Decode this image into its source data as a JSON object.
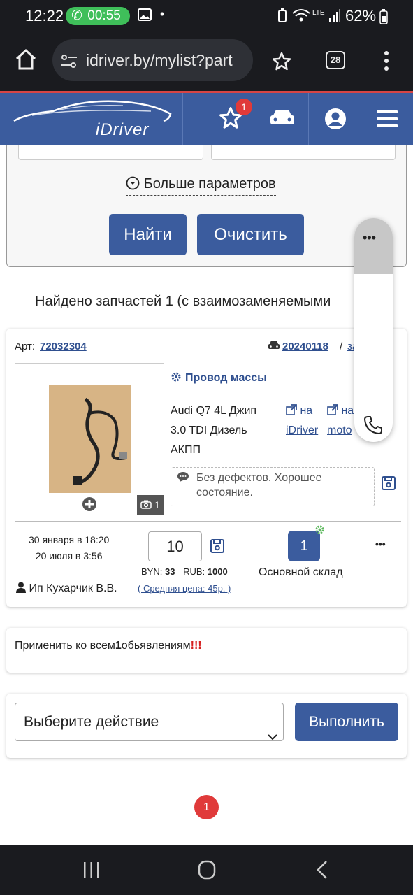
{
  "status_bar": {
    "time": "12:22",
    "call_timer": "00:55",
    "network": "LTE",
    "battery": "62%"
  },
  "browser": {
    "url": "idriver.by/mylist?part",
    "tab_count": "28"
  },
  "site_header": {
    "logo": "iDriver",
    "favorites_badge": "1"
  },
  "search_panel": {
    "more_params_label": "Больше параметров",
    "find_button": "Найти",
    "clear_button": "Очистить"
  },
  "results": {
    "found_text": "Найдено запчастей 1 (с взаимозаменяемыми"
  },
  "part_card": {
    "art_label": "Арт:",
    "art_number": "72032304",
    "car_link": "20240118",
    "separator": "/",
    "extra_link": "за...ии",
    "part_name": "Провод массы",
    "car_lines": [
      "Audi Q7 4L Джип",
      "3.0 TDI Дизель",
      "АКПП"
    ],
    "link_na_top": "на",
    "link_na_bottom": "iDriver",
    "link_na2_top": "на",
    "link_na2_bottom": "moto",
    "photo_count": "1",
    "description": "Без дефектов. Хорошее состояние.",
    "date_created": "30 января в 18:20",
    "date_updated": "20 июля в 3:56",
    "seller": "Ип Кухарчик В.В.",
    "price_value": "10",
    "byn_label": "BYN:",
    "byn_value": "33",
    "rub_label": "RUB:",
    "rub_value": "1000",
    "avg_price": "( Средняя цена: 45р. )",
    "stock_count": "1",
    "warehouse": "Основной склад",
    "more_menu": "•••"
  },
  "apply_all": {
    "prefix": "Применить ко всем",
    "count": "1",
    "suffix": "обьявлениям",
    "marks": "!!!"
  },
  "bulk_action": {
    "select_placeholder": "Выберите действие",
    "execute_button": "Выполнить"
  },
  "pagination": {
    "current_page": "1"
  },
  "floating_widget": {
    "menu": "•••"
  },
  "colors": {
    "brand_blue": "#3b5c9e",
    "badge_red": "#e03a3a",
    "call_green": "#3fbf5a"
  }
}
